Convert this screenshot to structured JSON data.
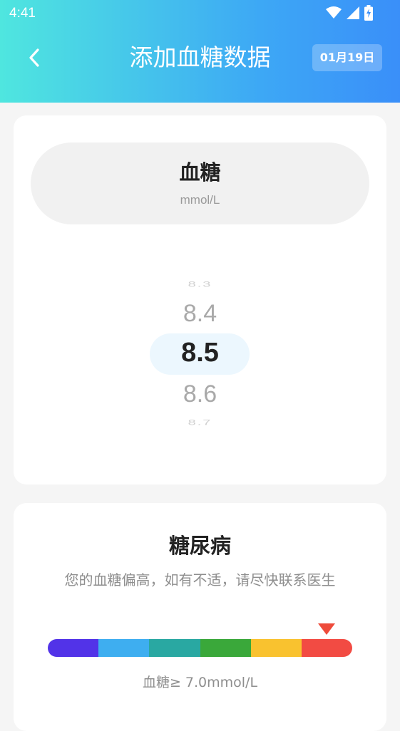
{
  "status_bar": {
    "time": "4:41",
    "icons": [
      "wifi-icon",
      "signal-icon",
      "battery-charging-icon"
    ]
  },
  "header": {
    "title": "添加血糖数据",
    "date": "01月19日",
    "back_icon": "chevron-left-icon"
  },
  "measurement": {
    "label": "血糖",
    "unit": "mmol/L"
  },
  "picker": {
    "values": [
      "8.3",
      "8.4",
      "8.5",
      "8.6",
      "8.7"
    ],
    "selected": "8.5"
  },
  "result": {
    "title": "糖尿病",
    "description": "您的血糖偏高，如有不适，请尽快联系医生",
    "range_label": "血糖≥ 7.0mmol/L",
    "scale_colors": [
      "#5233e8",
      "#3eaef0",
      "#29a8a2",
      "#3aa83a",
      "#f9c22f",
      "#f24b43"
    ],
    "marker_color": "#ee4b3b",
    "active_segment": 5
  },
  "colors": {
    "header_gradient_start": "#4fe6df",
    "header_gradient_end": "#3a8ff9",
    "picker_highlight": "#ecf7fe"
  }
}
